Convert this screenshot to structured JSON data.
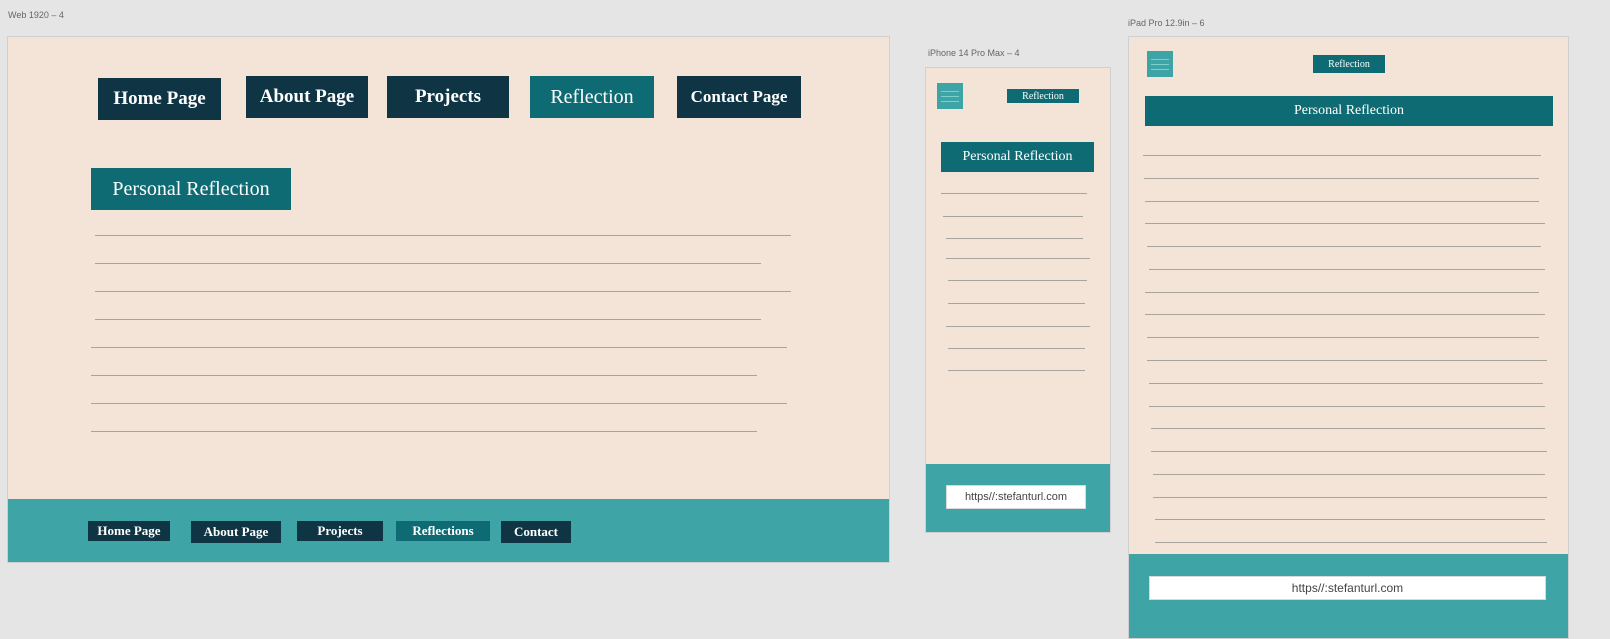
{
  "artboards": {
    "web": {
      "label": "Web 1920 – 4",
      "nav": [
        {
          "label": "Home Page",
          "active": false
        },
        {
          "label": "About Page",
          "active": false
        },
        {
          "label": "Projects",
          "active": false
        },
        {
          "label": "Reflection",
          "active": true
        },
        {
          "label": "Contact Page",
          "active": false
        }
      ],
      "title": "Personal Reflection",
      "footer_nav": [
        {
          "label": "Home Page",
          "active": false
        },
        {
          "label": "About Page",
          "active": false
        },
        {
          "label": "Projects",
          "active": false
        },
        {
          "label": "Reflections",
          "active": true
        },
        {
          "label": "Contact",
          "active": false
        }
      ]
    },
    "iphone": {
      "label": "iPhone 14 Pro Max – 4",
      "button": "Reflection",
      "title": "Personal Reflection",
      "url": "https//:stefanturl.com"
    },
    "ipad": {
      "label": "iPad Pro 12.9in – 6",
      "button": "Reflection",
      "title": "Personal Reflection",
      "url": "https//:stefanturl.com"
    }
  },
  "colors": {
    "canvas": "#e5e5e5",
    "page": "#f3e4d7",
    "dark_button": "#0f3444",
    "active_teal": "#0e6b73",
    "footer_teal": "#3fa4a6"
  },
  "icons": [
    "hamburger-menu-icon"
  ]
}
